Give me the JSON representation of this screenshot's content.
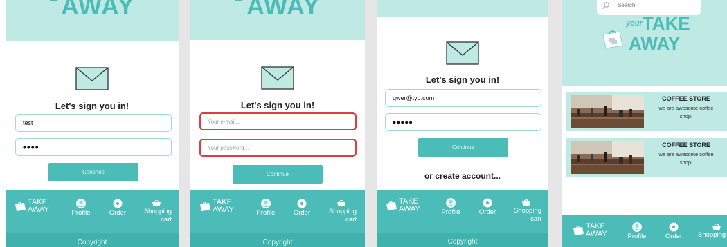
{
  "brand": {
    "line1": "TAKE",
    "line2": "AWAY",
    "your": "your",
    "top_partial": "AWAY"
  },
  "colors": {
    "teal": "#4bbcb7",
    "mint": "#bfe9e3",
    "error": "#e03c44"
  },
  "signin": {
    "heading": "Let's sign you in!",
    "continue_label": "Continue",
    "create_account": "or create account..."
  },
  "screens": {
    "one": {
      "email_value": "test",
      "password_value": "••••"
    },
    "two": {
      "email_placeholder": "Your e-mail...",
      "password_placeholder": "Your password..."
    },
    "three": {
      "email_value": "qwer@tyu.com",
      "password_value": "•••••"
    },
    "four": {
      "search_placeholder": "Search"
    }
  },
  "nav": {
    "profile": "Profile",
    "order": "Order",
    "cart_line1": "Shopping",
    "cart_line2": "cart",
    "cart_short": "Shopping",
    "copyright": "Copyright"
  },
  "icons": {
    "mail": "envelope-icon",
    "profile": "person-icon",
    "order": "record-icon",
    "cart": "basket-icon",
    "search": "magnifier-icon"
  },
  "stores": [
    {
      "title": "COFFEE STORE",
      "desc_line1": "we are awesome coffee",
      "desc_line2": "shop!"
    },
    {
      "title": "COFFEE STORE",
      "desc_line1": "we are awesome coffee",
      "desc_line2": "shop!"
    }
  ]
}
